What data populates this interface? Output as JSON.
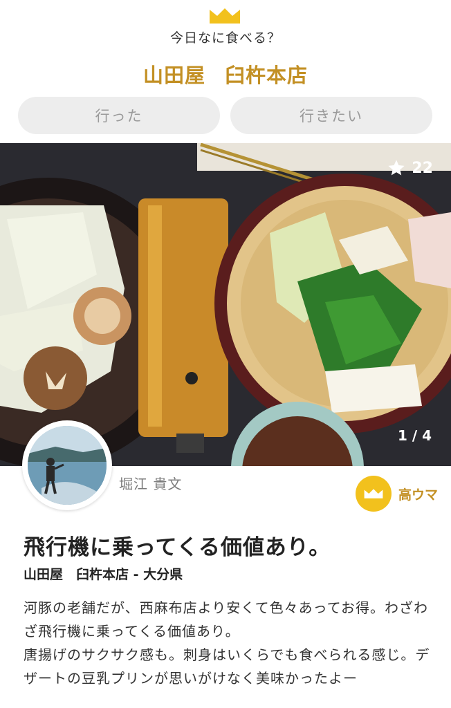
{
  "header": {
    "crown_icon": "crown-icon",
    "app_title": "今日なに食べる？",
    "shop_name_part1": "山田屋",
    "shop_name_part2": "臼杵本店"
  },
  "actions": {
    "went_label": "行った",
    "want_label": "行きたい"
  },
  "photo": {
    "likes": "22",
    "counter": "1 / 4"
  },
  "user": {
    "name": "堀江 貴文",
    "rating_label": "高ウマ"
  },
  "post": {
    "title": "飛行機に乗ってくる価値あり。",
    "subtitle": "山田屋　臼杵本店 - 大分県",
    "body": [
      "河豚の老舗だが、西麻布店より安くて色々あってお得。わざわざ飛行機に乗ってくる価値あり。",
      "唐揚げのサクサク感も。刺身はいくらでも食べられる感じ。デザートの豆乳プリンが思いがけなく美味かったよー"
    ]
  },
  "colors": {
    "accent": "#c39024",
    "crown": "#f2c11d",
    "button_bg": "#ededed"
  }
}
